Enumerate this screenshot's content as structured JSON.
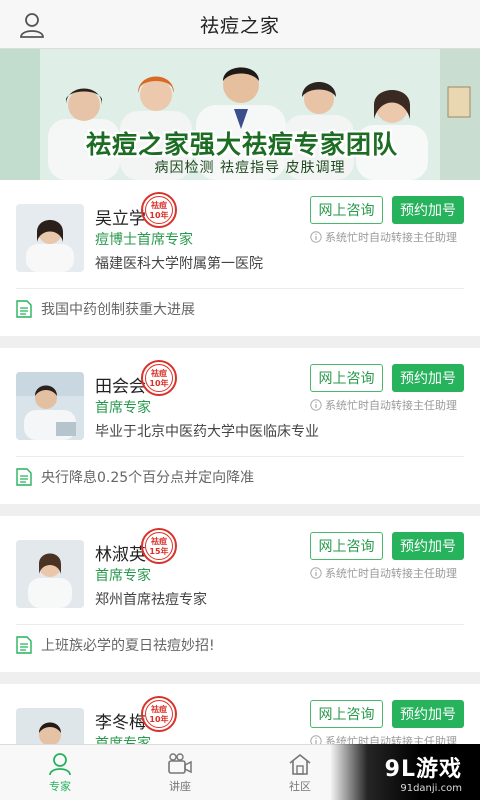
{
  "header": {
    "title": "祛痘之家"
  },
  "banner": {
    "headline": "祛痘之家强大祛痘专家团队",
    "subline": "病因检测  祛痘指导  皮肤调理"
  },
  "doctors": [
    {
      "name": "吴立学",
      "rank": "痘博士首席专家",
      "hospital": "福建医科大学附属第一医院",
      "news": "我国中药创制获重大进展",
      "online_label": "网上咨询",
      "book_label": "预约加号",
      "notice": "系统忙时自动转接主任助理",
      "seal_top": "祛痘",
      "seal_bottom": "10年"
    },
    {
      "name": "田会会",
      "rank": "首席专家",
      "hospital": "毕业于北京中医药大学中医临床专业",
      "news": "央行降息0.25个百分点并定向降准",
      "online_label": "网上咨询",
      "book_label": "预约加号",
      "notice": "系统忙时自动转接主任助理",
      "seal_top": "祛痘",
      "seal_bottom": "10年"
    },
    {
      "name": "林淑英",
      "rank": "首席专家",
      "hospital": "郑州首席祛痘专家",
      "news": "上班族必学的夏日祛痘妙招!",
      "online_label": "网上咨询",
      "book_label": "预约加号",
      "notice": "系统忙时自动转接主任助理",
      "seal_top": "祛痘",
      "seal_bottom": "15年"
    },
    {
      "name": "李冬梅",
      "rank": "首席专家",
      "hospital": "",
      "news": "",
      "online_label": "网上咨询",
      "book_label": "预约加号",
      "notice": "系统忙时自动转接主任助理",
      "seal_top": "祛痘",
      "seal_bottom": "10年"
    }
  ],
  "tabs": [
    {
      "label": "专家",
      "icon": "person-icon",
      "active": true
    },
    {
      "label": "讲座",
      "icon": "video-camera-icon",
      "active": false
    },
    {
      "label": "社区",
      "icon": "home-icon",
      "active": false
    },
    {
      "label": "",
      "icon": "",
      "active": false
    }
  ],
  "watermark": {
    "main": "9L游戏",
    "sub": "91danji.com"
  },
  "colors": {
    "accent": "#27b25c",
    "seal": "#d9322a"
  }
}
